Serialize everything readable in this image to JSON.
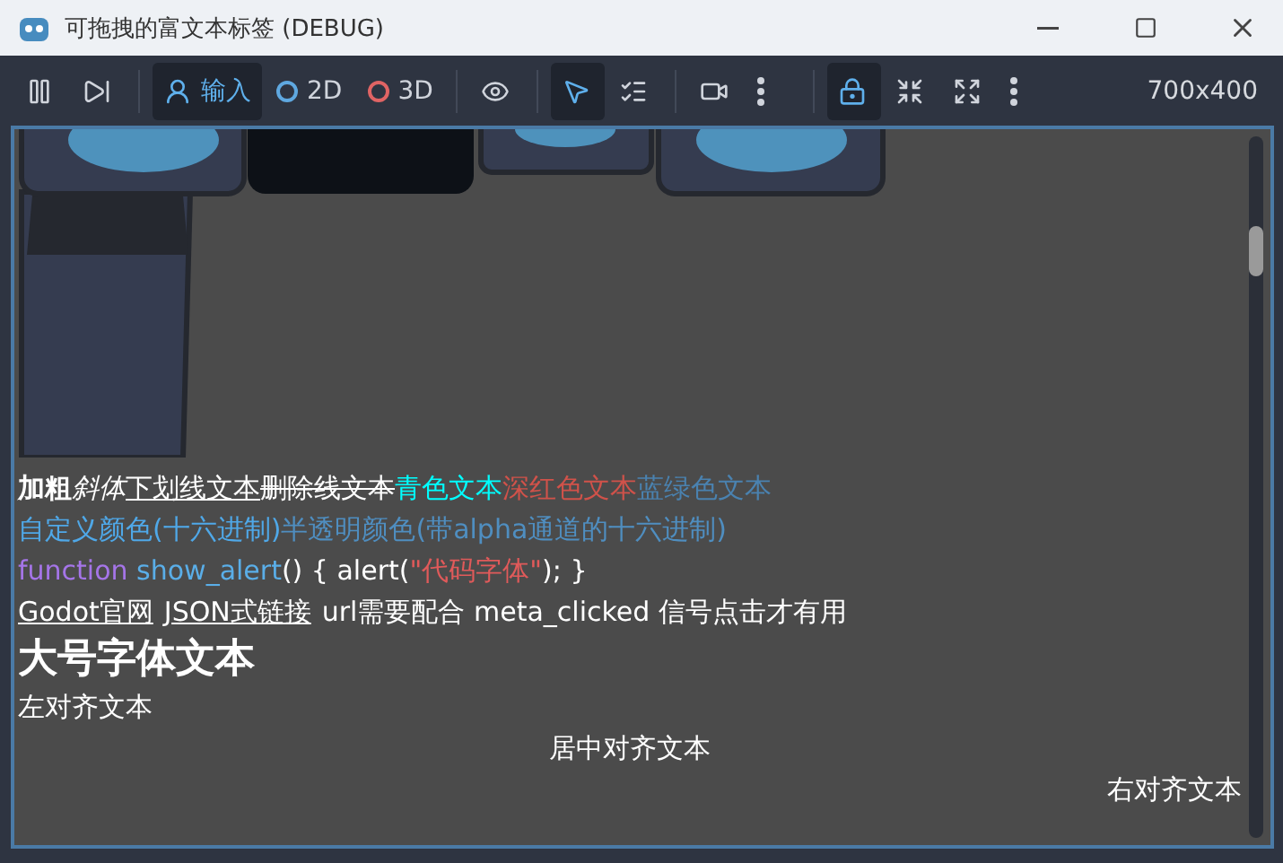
{
  "window": {
    "title": "可拖拽的富文本标签 (DEBUG)"
  },
  "toolbar": {
    "groups": [
      [
        {
          "kind": "pause",
          "selected": false
        },
        {
          "kind": "step",
          "selected": false
        }
      ],
      [
        {
          "kind": "input",
          "label": "输入",
          "selected": true
        },
        {
          "kind": "radio",
          "label": "2D",
          "color": "#5fa8e0",
          "selected": false
        },
        {
          "kind": "radio",
          "label": "3D",
          "color": "#e06464",
          "selected": false
        }
      ],
      [
        {
          "kind": "eye",
          "selected": false
        }
      ],
      [
        {
          "kind": "pointer",
          "selected": true
        },
        {
          "kind": "list-pointer",
          "selected": false
        }
      ],
      [
        {
          "kind": "camera",
          "selected": false
        },
        {
          "kind": "more",
          "selected": false
        }
      ],
      [
        {
          "kind": "lock",
          "selected": true
        },
        {
          "kind": "shrink",
          "selected": false
        },
        {
          "kind": "expand",
          "selected": false
        },
        {
          "kind": "more",
          "selected": false
        }
      ]
    ],
    "resolution": "700x400"
  },
  "rich_text": {
    "lines": [
      [
        {
          "kind": "bold",
          "text": "加粗"
        },
        {
          "kind": "italic",
          "text": "斜体"
        },
        {
          "kind": "underline",
          "text": "下划线文本"
        },
        {
          "kind": "strike",
          "text": "删除线文本"
        },
        {
          "kind": "color",
          "text": "青色文本",
          "color": "#00ffff"
        },
        {
          "kind": "color",
          "text": "深红色文本",
          "color": "#d0524a"
        },
        {
          "kind": "color",
          "text": "蓝绿色文本",
          "color": "#4a82b0"
        }
      ],
      [
        {
          "kind": "color",
          "text": "自定义颜色(十六进制)",
          "color": "#4fa8e8"
        },
        {
          "kind": "color",
          "text": "半透明颜色(带alpha通道的十六进制)",
          "color": "#4f8ec0"
        }
      ],
      [
        {
          "kind": "color",
          "text": "function",
          "color": "#a575e8"
        },
        {
          "kind": "color",
          "text": " show_alert",
          "color": "#5aaee8"
        },
        {
          "kind": "plain",
          "text": "() { alert("
        },
        {
          "kind": "color",
          "text": "\"代码字体\"",
          "color": "#e05a5a"
        },
        {
          "kind": "plain",
          "text": "); }"
        }
      ],
      [
        {
          "kind": "link",
          "text": "Godot官网"
        },
        {
          "kind": "link",
          "text": "JSON式链接"
        },
        {
          "kind": "plain",
          "text": "url需要配合 meta_clicked 信号点击才有用"
        }
      ]
    ],
    "large": "大号字体文本",
    "left": "左对齐文本",
    "center": "居中对齐文本",
    "right": "右对齐文本"
  }
}
